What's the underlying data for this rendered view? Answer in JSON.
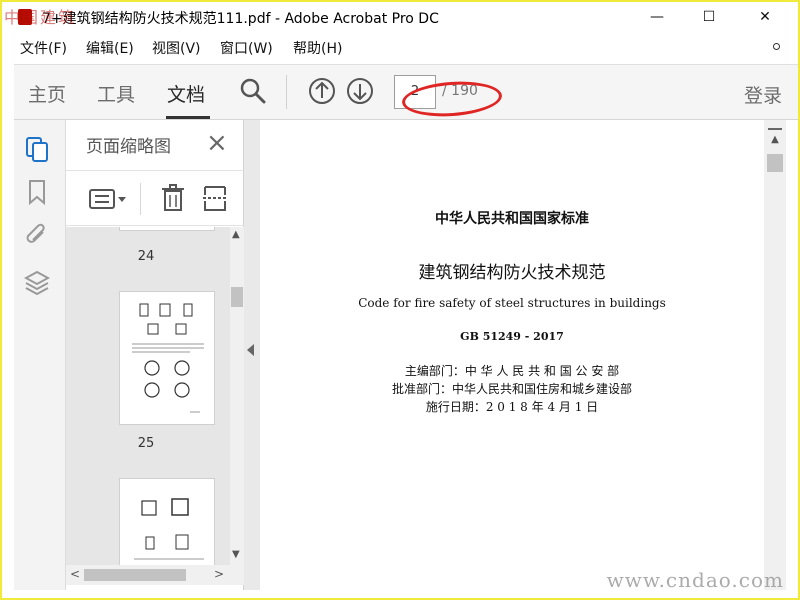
{
  "window": {
    "title": "7+建筑钢结构防火技术规范111.pdf - Adobe Acrobat Pro DC",
    "minimize": "—",
    "maximize": "☐",
    "close": "✕",
    "watermark_cn": "中国建筑"
  },
  "menu": {
    "file": "文件(F)",
    "edit": "编辑(E)",
    "view": "视图(V)",
    "window": "窗口(W)",
    "help": "帮助(H)"
  },
  "toolbar": {
    "home": "主页",
    "tools": "工具",
    "document": "文档",
    "page_input": "2",
    "page_count": "/ 190",
    "login": "登录",
    "annotation_color": "#e02525"
  },
  "thumbnails": {
    "panel_title": "页面缩略图",
    "pages": [
      {
        "label": "24"
      },
      {
        "label": "25"
      }
    ]
  },
  "document": {
    "heading": "中华人民共和国国家标准",
    "title_cn": "建筑钢结构防火技术规范",
    "title_en": "Code for fire safety of steel structures in buildings",
    "code": "GB 51249 - 2017",
    "line1": "主编部门：中 华 人 民 共 和 国 公 安 部",
    "line2": "批准部门：中华人民共和国住房和城乡建设部",
    "line3": "施行日期：2 0 1 8 年 4 月 1 日"
  },
  "footer": {
    "watermark_url": "www.cndao.com"
  }
}
